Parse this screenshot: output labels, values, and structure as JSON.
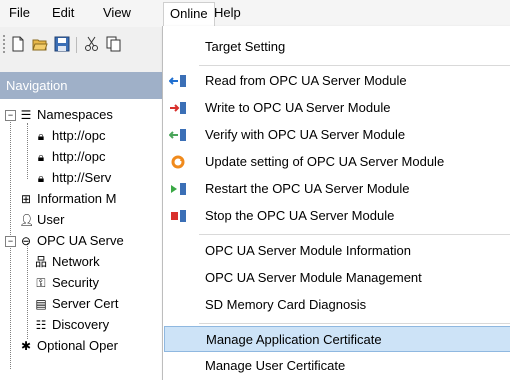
{
  "menubar": {
    "items": [
      "File",
      "Edit",
      "View",
      "Online",
      "Help"
    ]
  },
  "navigation": {
    "title": "Navigation",
    "tree": [
      {
        "label": "Namespaces"
      },
      {
        "label": "http://opc"
      },
      {
        "label": "http://opc"
      },
      {
        "label": "http://Serv"
      },
      {
        "label": "Information M"
      },
      {
        "label": "User"
      },
      {
        "label": "OPC UA Serve"
      },
      {
        "label": "Network"
      },
      {
        "label": "Security"
      },
      {
        "label": "Server Cert"
      },
      {
        "label": "Discovery"
      },
      {
        "label": "Optional Oper"
      }
    ]
  },
  "online_menu": {
    "items": [
      {
        "label": "Target Setting",
        "icon": "none"
      },
      {
        "label": "Read from OPC UA Server Module",
        "icon": "read-icon"
      },
      {
        "label": "Write to OPC UA Server Module",
        "icon": "write-icon"
      },
      {
        "label": "Verify with OPC UA Server Module",
        "icon": "verify-icon"
      },
      {
        "label": "Update setting of OPC UA Server Module",
        "icon": "update-icon"
      },
      {
        "label": "Restart the OPC UA Server Module",
        "icon": "restart-icon"
      },
      {
        "label": "Stop the OPC UA Server Module",
        "icon": "stop-icon"
      },
      {
        "label": "OPC UA Server Module Information",
        "icon": "none"
      },
      {
        "label": "OPC UA Server Module Management",
        "icon": "none"
      },
      {
        "label": "SD Memory Card Diagnosis",
        "icon": "none"
      },
      {
        "label": "Manage Application Certificate",
        "icon": "none",
        "highlighted": true
      },
      {
        "label": "Manage User Certificate",
        "icon": "none"
      }
    ],
    "colors": {
      "highlight": "#cde3f7",
      "highlight_border": "#8fb8e0"
    }
  }
}
